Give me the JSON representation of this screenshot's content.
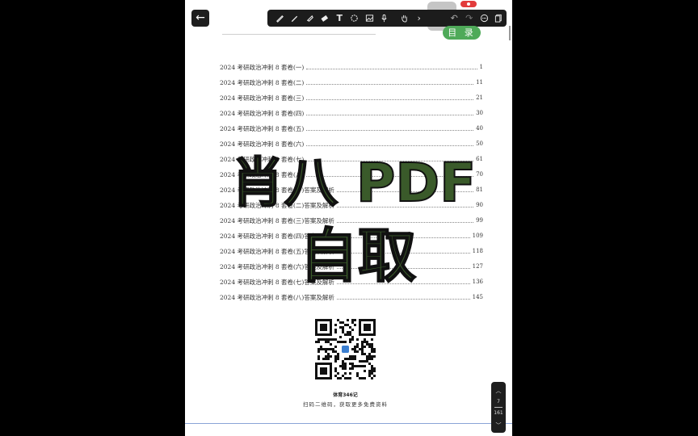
{
  "toolbar": {
    "back_icon": "arrow-left-icon",
    "tools": [
      "pen-icon",
      "pencil-icon",
      "highlighter-icon",
      "eraser-icon",
      "text-icon",
      "lasso-icon",
      "image-icon",
      "mic-icon",
      "hand-icon",
      "chevron-right-icon",
      "undo-icon",
      "redo-icon",
      "more-icon",
      "pages-icon"
    ]
  },
  "toc_tag": "目 录",
  "toc": [
    {
      "title": "2024 考研政治冲刺 8 套卷(一)",
      "page": "1"
    },
    {
      "title": "2024 考研政治冲刺 8 套卷(二)",
      "page": "11"
    },
    {
      "title": "2024 考研政治冲刺 8 套卷(三)",
      "page": "21"
    },
    {
      "title": "2024 考研政治冲刺 8 套卷(四)",
      "page": "30"
    },
    {
      "title": "2024 考研政治冲刺 8 套卷(五)",
      "page": "40"
    },
    {
      "title": "2024 考研政治冲刺 8 套卷(六)",
      "page": "50"
    },
    {
      "title": "2024 考研政治冲刺 8 套卷(七)",
      "page": "61"
    },
    {
      "title": "2024 考研政治冲刺 8 套卷(八)",
      "page": "70"
    },
    {
      "title": "2024 考研政治冲刺 8 套卷(一)答案及解析",
      "page": "81"
    },
    {
      "title": "2024 考研政治冲刺 8 套卷(二)答案及解析",
      "page": "90"
    },
    {
      "title": "2024 考研政治冲刺 8 套卷(三)答案及解析",
      "page": "99"
    },
    {
      "title": "2024 考研政治冲刺 8 套卷(四)答案及解析",
      "page": "109"
    },
    {
      "title": "2024 考研政治冲刺 8 套卷(五)答案及解析",
      "page": "118"
    },
    {
      "title": "2024 考研政治冲刺 8 套卷(六)答案及解析",
      "page": "127"
    },
    {
      "title": "2024 考研政治冲刺 8 套卷(七)答案及解析",
      "page": "136"
    },
    {
      "title": "2024 考研政治冲刺 8 套卷(八)答案及解析",
      "page": "145"
    }
  ],
  "watermark": {
    "line1": "肖八 PDF",
    "line2": "自取",
    "color": "#3a5a2a"
  },
  "qr": {
    "name": "体育346记",
    "caption": "扫码二维码，获取更多免费资料"
  },
  "page_nav": {
    "current": "7",
    "total": "161"
  }
}
